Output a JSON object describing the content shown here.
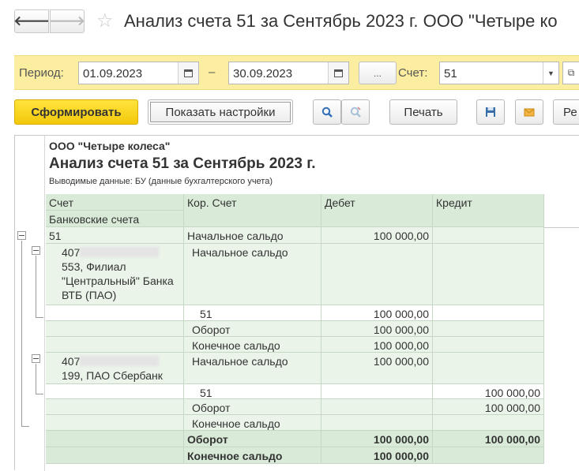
{
  "window": {
    "title": "Анализ счета 51 за Сентябрь 2023 г. ООО \"Четыре ко"
  },
  "params": {
    "period_label": "Период:",
    "date_from": "01.09.2023",
    "dash": "–",
    "date_to": "30.09.2023",
    "dots": "...",
    "account_label": "Счет:",
    "account_value": "51"
  },
  "toolbar": {
    "generate": "Сформировать",
    "show_settings": "Показать настройки",
    "print": "Печать",
    "more": "Ре"
  },
  "report": {
    "org": "ООО \"Четыре колеса\"",
    "title": "Анализ счета 51 за Сентябрь 2023 г.",
    "subtitle": "Выводимые данные:  БУ (данные бухгалтерского учета)",
    "headers": {
      "account": "Счет",
      "bank_accounts": "Банковские счета",
      "corr_account": "Кор. Счет",
      "debit": "Дебет",
      "credit": "Кредит"
    },
    "rows": {
      "acc51": "51",
      "opening": "Начальное сальдо",
      "opening_debit": "100 000,00",
      "vtb_prefix": "407",
      "vtb_rest": "553, Филиал \"Центральный\" Банка ВТБ (ПАО)",
      "vtb_opening": "Начальное сальдо",
      "vtb_51": "51",
      "vtb_51_debit": "100 000,00",
      "vtb_turnover": "Оборот",
      "vtb_turnover_debit": "100 000,00",
      "vtb_closing": "Конечное сальдо",
      "vtb_closing_debit": "100 000,00",
      "sber_prefix": "407",
      "sber_rest": "199, ПАО Сбербанк",
      "sber_opening": "Начальное сальдо",
      "sber_opening_debit": "100 000,00",
      "sber_51": "51",
      "sber_51_credit": "100 000,00",
      "sber_turnover": "Оборот",
      "sber_turnover_credit": "100 000,00",
      "sber_closing": "Конечное сальдо",
      "total_turnover": "Оборот",
      "total_turnover_debit": "100 000,00",
      "total_turnover_credit": "100 000,00",
      "total_closing": "Конечное сальдо",
      "total_closing_debit": "100 000,00"
    }
  }
}
